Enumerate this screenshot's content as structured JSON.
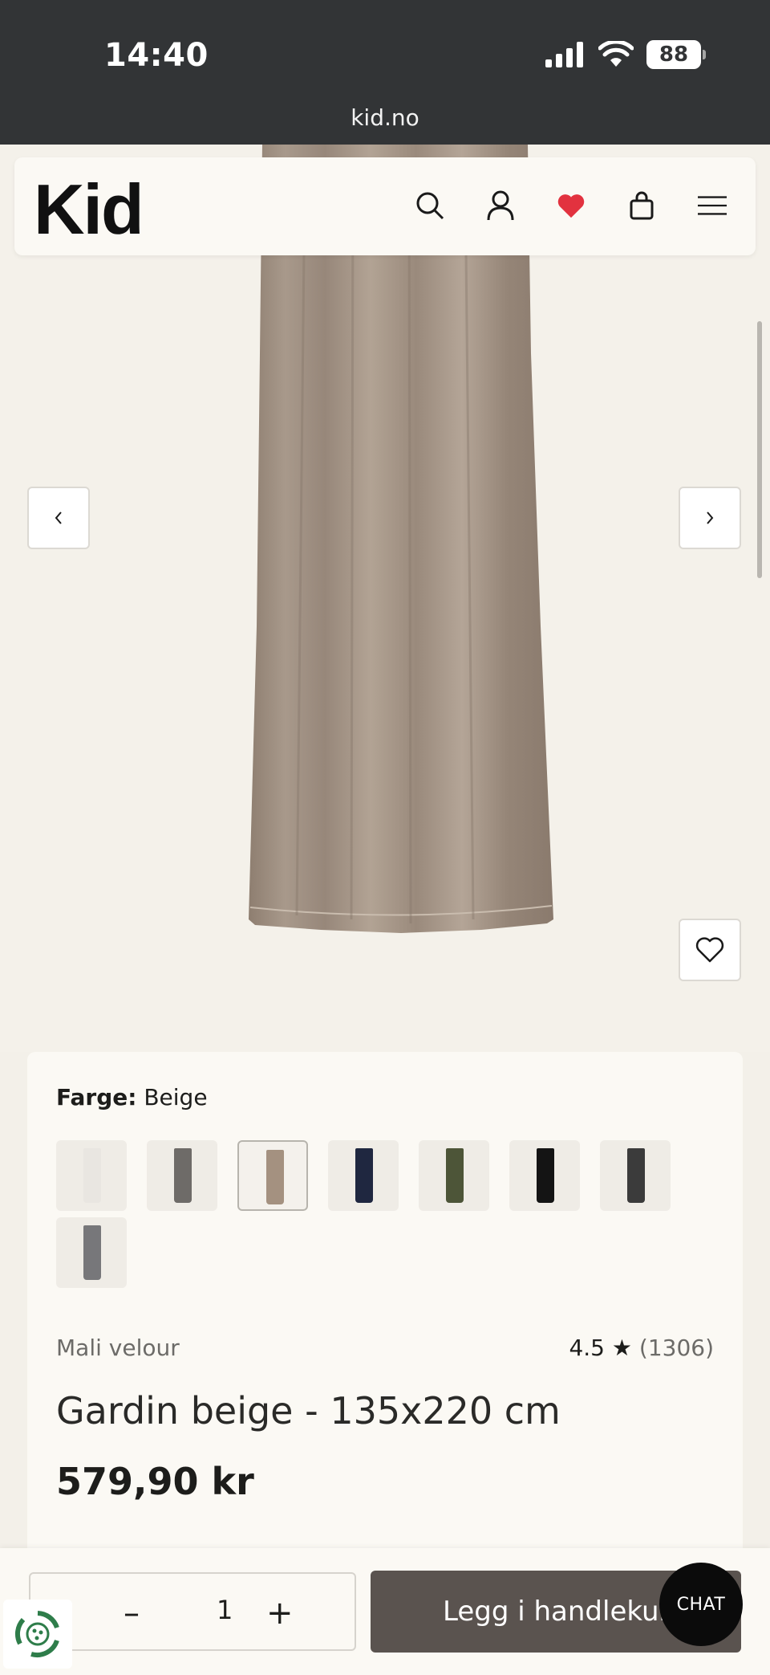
{
  "status_bar": {
    "time": "14:40",
    "battery": "88",
    "url": "kid.no"
  },
  "header": {
    "logo": "Kid"
  },
  "icons": {
    "search": "search-icon",
    "account": "user-icon",
    "wishlist": "heart-filled-icon",
    "cart": "bag-icon",
    "menu": "hamburger-icon",
    "prev": "chevron-left-icon",
    "next": "chevron-right-icon",
    "favorite": "heart-outline-icon"
  },
  "colors": {
    "accent_heart": "#e2323f",
    "cta": "#5a534f",
    "status_bg": "#323436"
  },
  "product": {
    "color_label": "Farge:",
    "color_value": "Beige",
    "swatches": [
      {
        "name": "Hvit",
        "color": "#e9e6e1",
        "selected": false
      },
      {
        "name": "Grå",
        "color": "#6e6b68",
        "selected": false
      },
      {
        "name": "Beige",
        "color": "#a49180",
        "selected": true
      },
      {
        "name": "Navy",
        "color": "#1f2740",
        "selected": false
      },
      {
        "name": "Grønn",
        "color": "#4d5538",
        "selected": false
      },
      {
        "name": "Svart",
        "color": "#141414",
        "selected": false
      },
      {
        "name": "Mørkegrå",
        "color": "#3b3b3b",
        "selected": false
      },
      {
        "name": "Grå 2",
        "color": "#77777a",
        "selected": false
      }
    ],
    "brand": "Mali velour",
    "rating": "4.5",
    "rating_star": "★",
    "review_count": "(1306)",
    "title": "Gardin beige - 135x220 cm",
    "price": "579,90 kr"
  },
  "cart_bar": {
    "minus": "–",
    "quantity": "1",
    "plus": "+",
    "add_to_cart": "Legg i handlekurv",
    "chat": "CHAT"
  }
}
